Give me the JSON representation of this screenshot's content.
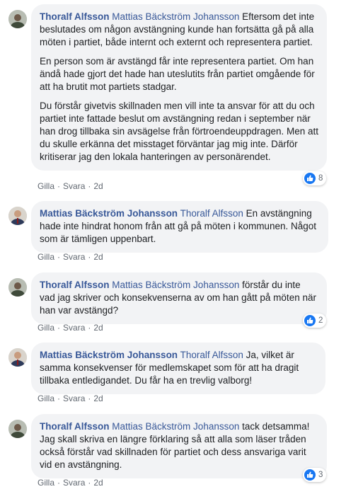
{
  "comments": [
    {
      "author": "Thoralf Alfsson",
      "mention": "Mattias Bäckström Johansson",
      "paragraphs": [
        "Eftersom det inte beslutades om någon avstängning kunde han fortsätta gå på alla möten i partiet, både internt och externt och representera partiet.",
        "En person som är avstängd får inte representera partiet. Om han ändå hade gjort det hade han uteslutits från partiet omgående för att ha brutit mot partiets stadgar.",
        "Du förstår givetvis skillnaden men vill inte ta ansvar för att du och partiet inte fattade beslut om avstängning redan i september när han drog tillbaka sin avsägelse från förtroendeuppdragen. Men att du skulle erkänna det misstaget förväntar jag mig inte. Därför kritiserar jag den lokala hanteringen av personärendet."
      ],
      "like_label": "Gilla",
      "reply_label": "Svara",
      "time": "2d",
      "reaction_count": "8"
    },
    {
      "author": "Mattias Bäckström Johansson",
      "mention": "Thoralf Alfsson",
      "paragraphs": [
        "En avstängning hade inte hindrat honom från att gå på möten i kommunen. Något som är tämligen uppenbart."
      ],
      "like_label": "Gilla",
      "reply_label": "Svara",
      "time": "2d",
      "reaction_count": ""
    },
    {
      "author": "Thoralf Alfsson",
      "mention": "Mattias Bäckström Johansson",
      "paragraphs": [
        "förstår du inte vad jag skriver och konsekvenserna av om han gått på möten när han var avstängd?"
      ],
      "like_label": "Gilla",
      "reply_label": "Svara",
      "time": "2d",
      "reaction_count": "2"
    },
    {
      "author": "Mattias Bäckström Johansson",
      "mention": "Thoralf Alfsson",
      "paragraphs": [
        "Ja, vilket är samma konsekvenser för medlemskapet som för att ha dragit tillbaka entledigandet. Du får ha en trevlig valborg!"
      ],
      "like_label": "Gilla",
      "reply_label": "Svara",
      "time": "2d",
      "reaction_count": ""
    },
    {
      "author": "Thoralf Alfsson",
      "mention": "Mattias Bäckström Johansson",
      "paragraphs": [
        "tack detsamma! Jag skall skriva en längre förklaring så att alla som läser tråden också förstår vad skillnaden för partiet och dess ansvariga varit vid en avstängning."
      ],
      "like_label": "Gilla",
      "reply_label": "Svara",
      "time": "2d",
      "reaction_count": "3"
    }
  ],
  "colors": {
    "bubble": "#f2f3f5",
    "name": "#385898",
    "meta": "#606770",
    "like": "#1877f2"
  },
  "icons": {
    "reaction": "thumbs-up-icon",
    "avatar_thoralf": "avatar-photo",
    "avatar_mattias": "avatar-photo"
  }
}
